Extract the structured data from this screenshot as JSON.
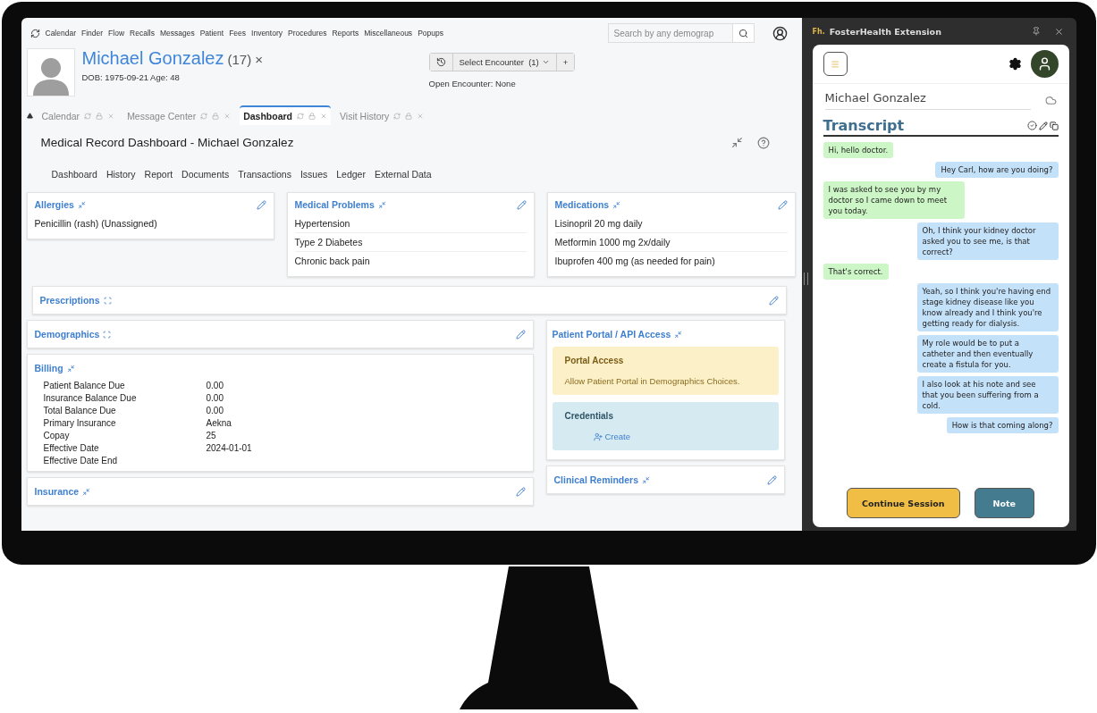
{
  "nav": {
    "items": [
      "Calendar",
      "Finder",
      "Flow",
      "Recalls",
      "Messages",
      "Patient",
      "Fees",
      "Inventory",
      "Procedures",
      "Reports",
      "Miscellaneous",
      "Popups"
    ]
  },
  "search": {
    "placeholder": "Search by any demograp"
  },
  "patient": {
    "name": "Michael Gonzalez",
    "count": "(17)",
    "close": "×",
    "dob_age": "DOB: 1975-09-21 Age: 48"
  },
  "encounter": {
    "select": "Select Encounter",
    "count": "(1)",
    "add": "+",
    "open": "Open Encounter: None"
  },
  "tabs": [
    {
      "label": "Calendar",
      "selected": false
    },
    {
      "label": "Message Center",
      "selected": false
    },
    {
      "label": "Dashboard",
      "selected": true
    },
    {
      "label": "Visit History",
      "selected": false
    }
  ],
  "page_title": "Medical Record Dashboard - Michael Gonzalez",
  "subnav": [
    "Dashboard",
    "History",
    "Report",
    "Documents",
    "Transactions",
    "Issues",
    "Ledger",
    "External Data"
  ],
  "top_cards": [
    {
      "title": "Allergies",
      "items": [
        "Penicillin (rash) (Unassigned)"
      ]
    },
    {
      "title": "Medical Problems",
      "items": [
        "Hypertension",
        "Type 2 Diabetes",
        "Chronic back pain"
      ]
    },
    {
      "title": "Medications",
      "items": [
        "Lisinopril 20 mg daily",
        "Metformin 1000 mg 2x/daily",
        "Ibuprofen 400 mg (as needed for pain)"
      ]
    }
  ],
  "prescriptions": {
    "title": "Prescriptions"
  },
  "demographics": {
    "title": "Demographics"
  },
  "billing": {
    "title": "Billing",
    "rows": [
      {
        "label": "Patient Balance Due",
        "value": "0.00"
      },
      {
        "label": "Insurance Balance Due",
        "value": "0.00"
      },
      {
        "label": "Total Balance Due",
        "value": "0.00"
      },
      {
        "label": "Primary Insurance",
        "value": "Aekna"
      },
      {
        "label": "Copay",
        "value": "25"
      },
      {
        "label": "Effective Date",
        "value": "2024-01-01"
      },
      {
        "label": "Effective Date End"
      }
    ]
  },
  "insurance": {
    "title": "Insurance"
  },
  "portal": {
    "title": "Patient Portal / API Access",
    "access_title": "Portal Access",
    "access_text": "Allow Patient Portal in Demographics Choices.",
    "credentials_title": "Credentials",
    "create": "Create"
  },
  "reminders": {
    "title": "Clinical Reminders"
  },
  "extension": {
    "brand": "Fh.",
    "title": "FosterHealth Extension",
    "patient_name": "Michael Gonzalez",
    "transcript_title": "Transcript",
    "messages": [
      {
        "kind": "incoming",
        "text": "Hi, hello doctor."
      },
      {
        "kind": "outgoing",
        "text": "Hey Carl, how are you doing?"
      },
      {
        "kind": "incoming",
        "text": "I was asked to see you by my doctor so I came down to meet you today."
      },
      {
        "kind": "outgoing",
        "text": "Oh, I think your kidney doctor asked you to see me, is that correct?"
      },
      {
        "kind": "incoming",
        "text": "That's correct."
      },
      {
        "kind": "outgoing",
        "text": "Yeah, so I think you're having end stage kidney disease like you know already and I think you're getting ready for dialysis."
      },
      {
        "kind": "outgoing",
        "text": "My role would be to put a catheter and then eventually create a fistula for you."
      },
      {
        "kind": "outgoing",
        "text": "I also look at his note and see that you been suffering from a cold."
      },
      {
        "kind": "outgoing",
        "text": "How is that coming along?"
      }
    ],
    "buttons": [
      {
        "label": "Continue Session",
        "kind": "primary"
      },
      {
        "label": "Note",
        "kind": "secondary"
      }
    ]
  }
}
